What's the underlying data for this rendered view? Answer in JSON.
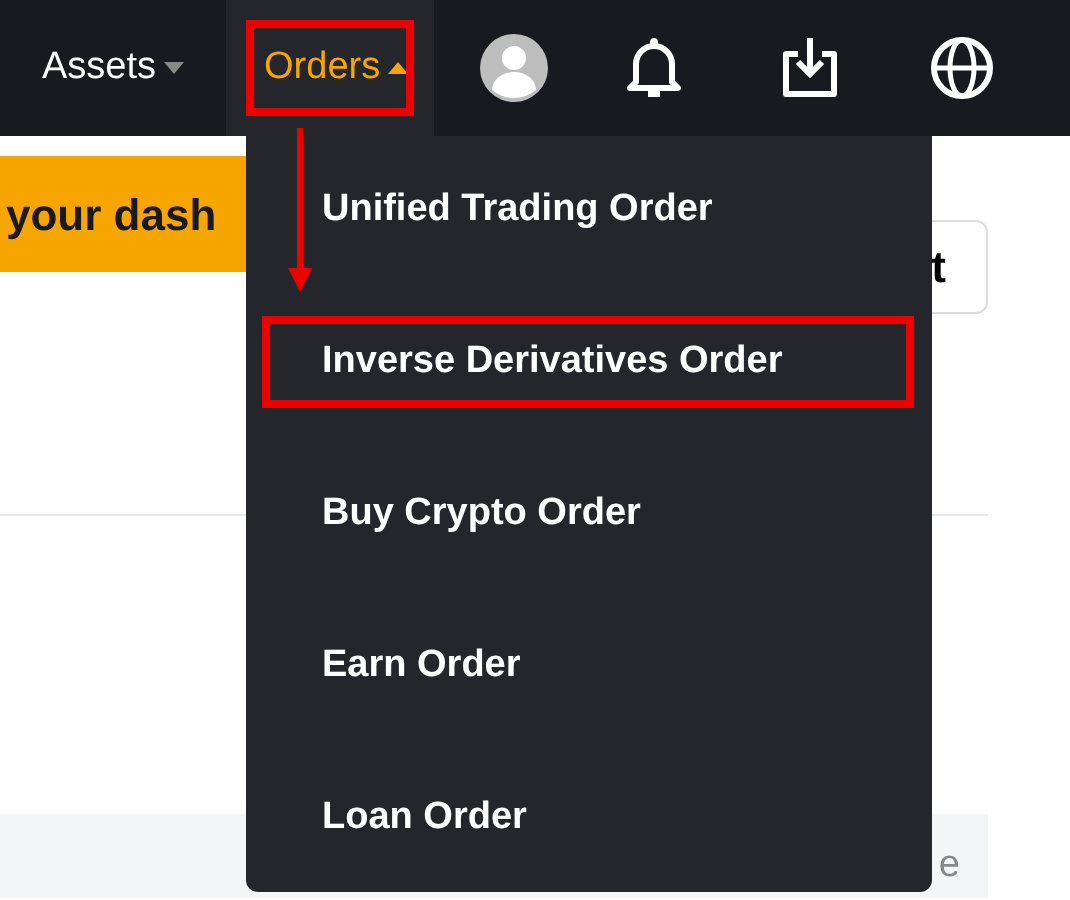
{
  "navbar": {
    "items": [
      {
        "label": "Assets",
        "expanded": false,
        "highlighted": false
      },
      {
        "label": "Orders",
        "expanded": true,
        "highlighted": true
      }
    ]
  },
  "page": {
    "banner": "your dash",
    "button": "t",
    "footer": "e"
  },
  "dropdown": {
    "items": [
      {
        "label": "Unified Trading Order",
        "highlighted": false
      },
      {
        "label": "Inverse Derivatives Order",
        "highlighted": true
      },
      {
        "label": "Buy Crypto Order",
        "highlighted": false
      },
      {
        "label": "Earn Order",
        "highlighted": false
      },
      {
        "label": "Loan Order",
        "highlighted": false
      }
    ]
  }
}
